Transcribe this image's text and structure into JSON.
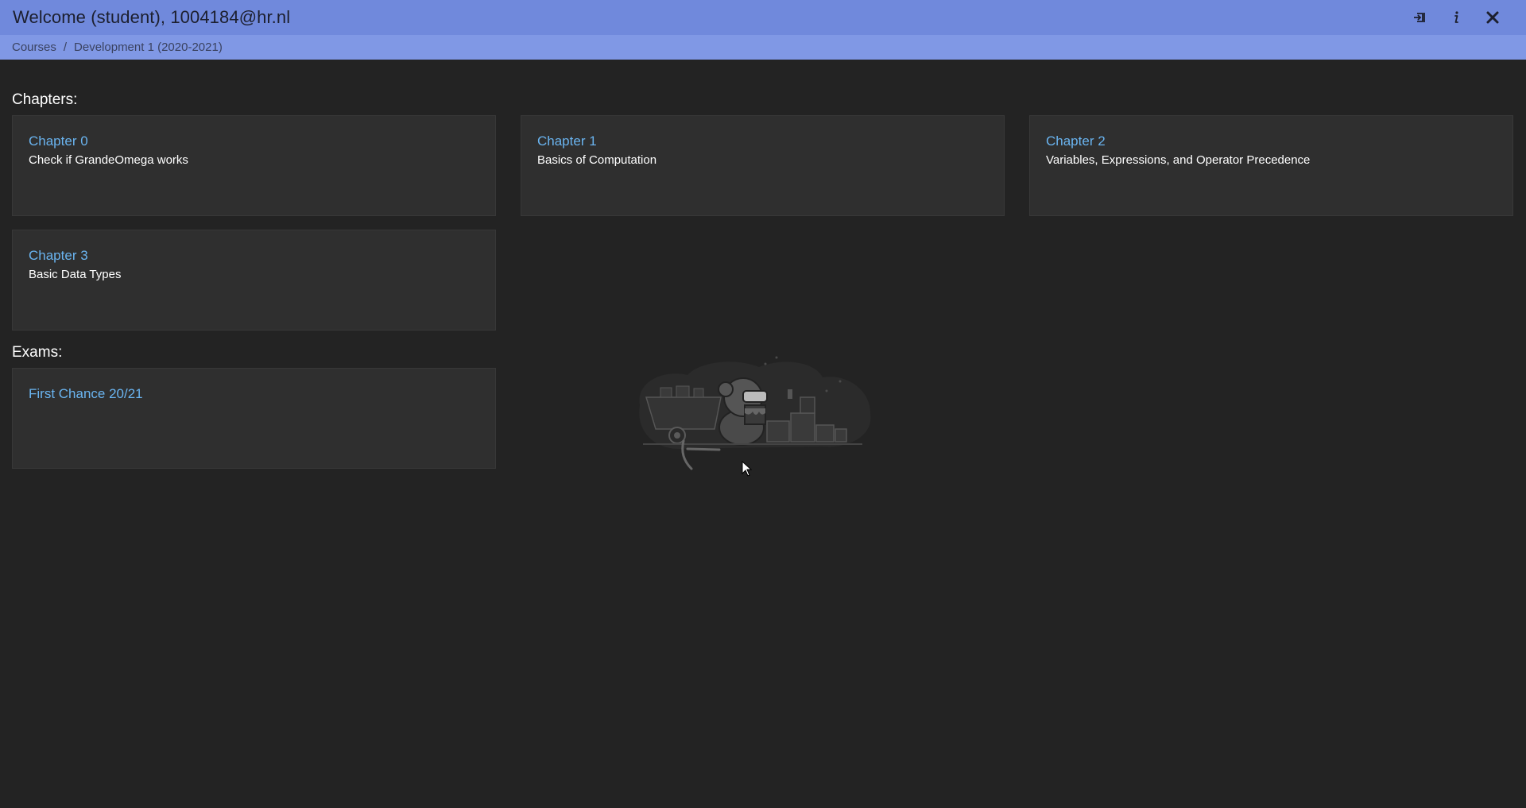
{
  "header": {
    "title": "Welcome (student), 1004184@hr.nl",
    "icons": [
      "logout-icon",
      "info-icon",
      "close-icon"
    ]
  },
  "breadcrumb": {
    "items": [
      "Courses",
      "Development 1 (2020-2021)"
    ],
    "separator": "/"
  },
  "chapters": {
    "label": "Chapters:",
    "items": [
      {
        "title": "Chapter 0",
        "subtitle": "Check if GrandeOmega works"
      },
      {
        "title": "Chapter 1",
        "subtitle": "Basics of Computation"
      },
      {
        "title": "Chapter 2",
        "subtitle": "Variables, Expressions, and Operator Precedence"
      },
      {
        "title": "Chapter 3",
        "subtitle": "Basic Data Types"
      }
    ]
  },
  "exams": {
    "label": "Exams:",
    "items": [
      {
        "title": "First Chance 20/21"
      }
    ]
  },
  "colors": {
    "header": "#7089dc",
    "breadcrumb": "#8098e5",
    "background": "#232323",
    "card": "#2f2f2f",
    "link": "#6ab4f0"
  }
}
